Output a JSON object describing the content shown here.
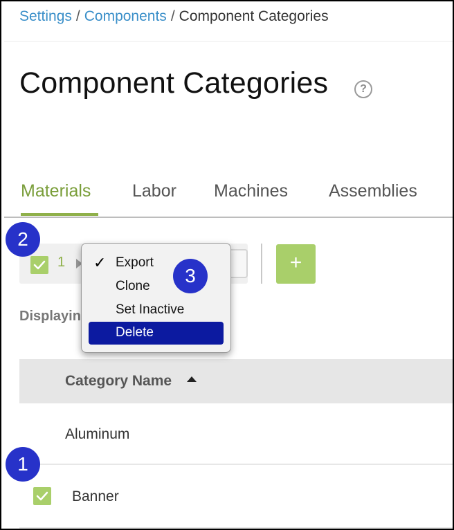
{
  "breadcrumb": {
    "settings": "Settings",
    "components": "Components",
    "current": "Component Categories",
    "separator": "/"
  },
  "page": {
    "title": "Component Categories",
    "help_icon": "question-circle-icon",
    "help_glyph": "?"
  },
  "tabs": [
    {
      "label": "Materials",
      "active": true
    },
    {
      "label": "Labor",
      "active": false
    },
    {
      "label": "Machines",
      "active": false
    },
    {
      "label": "Assemblies",
      "active": false
    }
  ],
  "toolbar": {
    "selected_count": "1",
    "add_glyph": "+"
  },
  "displaying_text": "Displayin",
  "context_menu": {
    "items": [
      {
        "label": "Export",
        "checked": true
      },
      {
        "label": "Clone",
        "checked": false
      },
      {
        "label": "Set Inactive",
        "checked": false
      },
      {
        "label": "Delete",
        "highlighted": true
      }
    ],
    "check_glyph": "✓"
  },
  "table": {
    "header": "Category Name",
    "sort": "ascending",
    "rows": [
      {
        "name": "Aluminum",
        "checked": false
      },
      {
        "name": "Banner",
        "checked": true
      }
    ]
  },
  "annotations": {
    "step1": "1",
    "step2": "2",
    "step3": "3"
  },
  "colors": {
    "accent_green": "#8fb04a",
    "link_blue": "#3a8fc9",
    "badge_blue": "#2732c9",
    "menu_highlight": "#0c1aa0"
  }
}
